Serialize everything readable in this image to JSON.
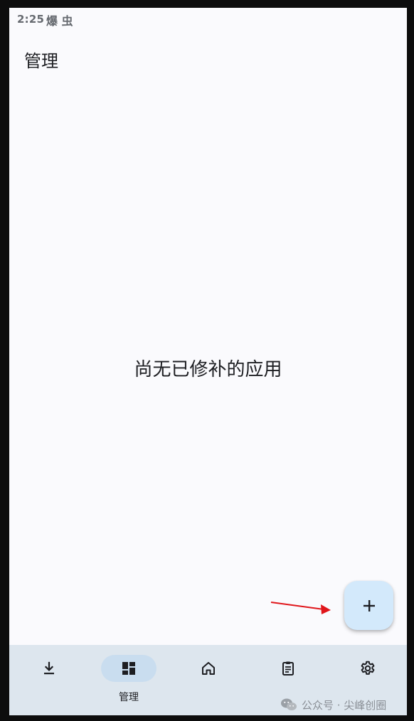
{
  "status_bar": {
    "time": "2:25",
    "icons_text": "爆 虫"
  },
  "header": {
    "title": "管理"
  },
  "main": {
    "empty_message": "尚无已修补的应用"
  },
  "fab": {
    "label": "+",
    "icon": "plus-icon"
  },
  "bottom_nav": {
    "items": [
      {
        "name": "downloads",
        "icon": "download-icon",
        "label": ""
      },
      {
        "name": "manage",
        "icon": "dashboard-icon",
        "label": "管理",
        "active": true
      },
      {
        "name": "home",
        "icon": "home-icon",
        "label": ""
      },
      {
        "name": "patches",
        "icon": "clipboard-icon",
        "label": ""
      },
      {
        "name": "settings",
        "icon": "gear-icon",
        "label": ""
      }
    ]
  },
  "watermark": {
    "text": "公众号 · 尖峰创圈"
  },
  "colors": {
    "background": "#fafafd",
    "nav_background": "#dde6ee",
    "nav_active_pill": "#c9ddef",
    "fab": "#d3e9fb",
    "annotation_arrow": "#e0161b",
    "text": "#1d1e22"
  }
}
